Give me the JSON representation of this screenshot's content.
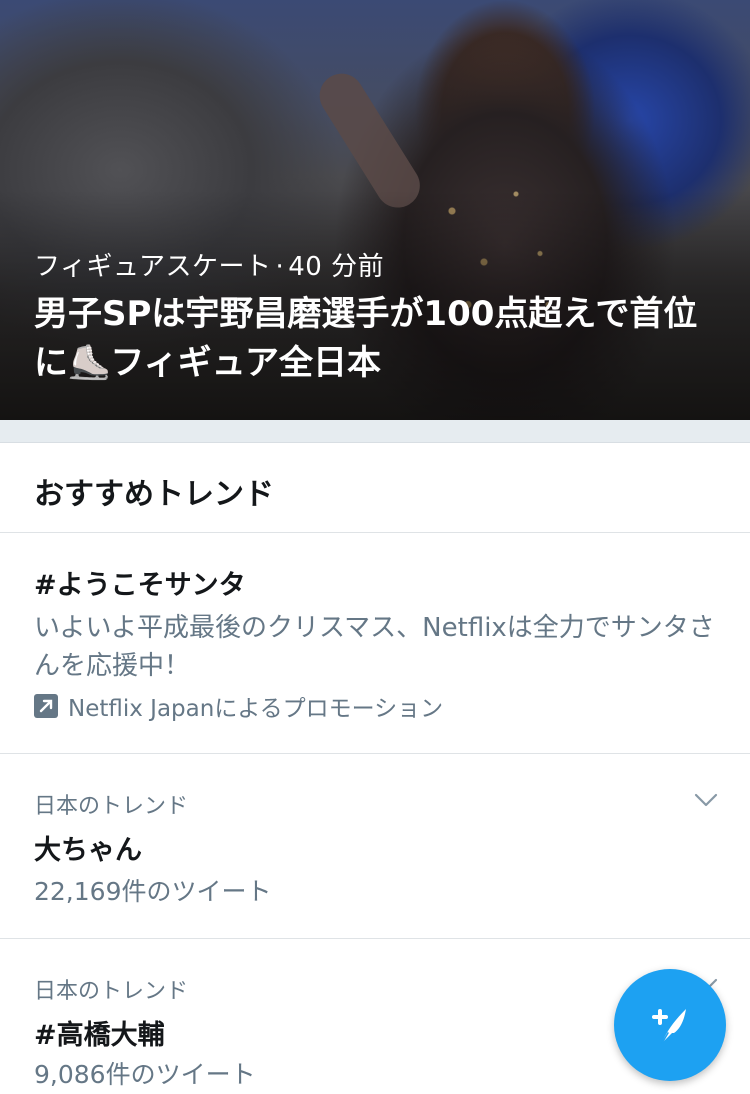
{
  "hero": {
    "category": "フィギュアスケート",
    "separator": "·",
    "time": "40 分前",
    "title_part1": "男子SPは宇野昌磨選手が100点超えで首位に",
    "title_emoji": "⛸️",
    "title_part2": "フィギュア全日本"
  },
  "section": {
    "title": "おすすめトレンド"
  },
  "promoted_trend": {
    "name": "#ようこそサンタ",
    "description": "いよいよ平成最後のクリスマス、Netflixは全力でサンタさんを応援中！",
    "promoted_by": "Netflix Japanによるプロモーション",
    "icon": "promoted-arrow-icon"
  },
  "trends": [
    {
      "context": "日本のトレンド",
      "name": "大ちゃん",
      "count": "22,169件のツイート"
    },
    {
      "context": "日本のトレンド",
      "name": "#高橋大輔",
      "count": "9,086件のツイート"
    }
  ],
  "compose_button": {
    "icon": "compose-feather-icon"
  },
  "colors": {
    "accent": "#1da1f2",
    "secondary_text": "#657786",
    "band": "#e6ecf0"
  }
}
